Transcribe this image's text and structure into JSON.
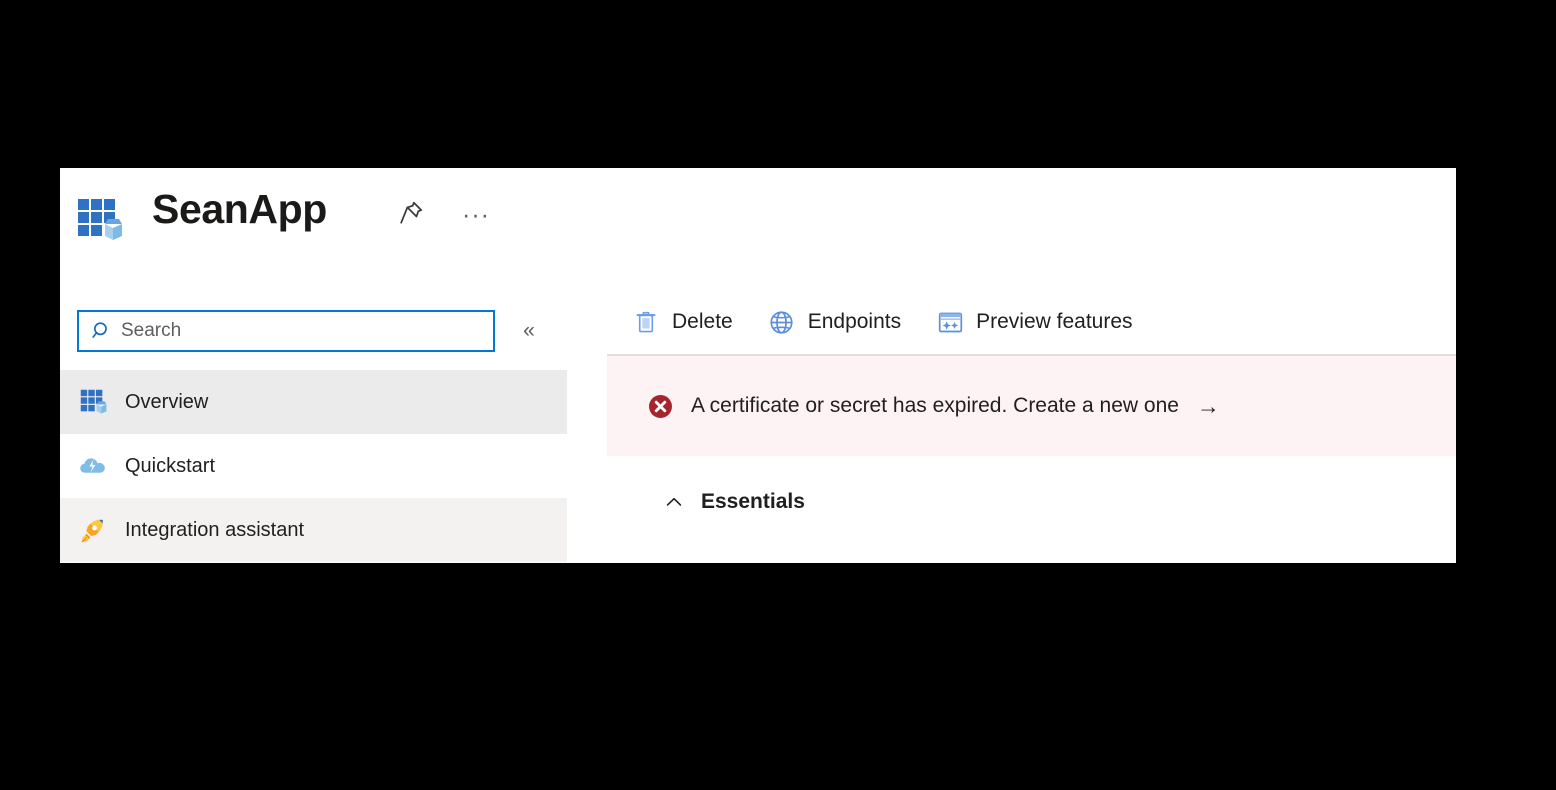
{
  "blade": {
    "title": "SeanApp",
    "app_icon": "app-registration-icon",
    "pin_icon": "pin-icon",
    "more_icon": "ellipsis-icon",
    "more_glyph": "···"
  },
  "search": {
    "placeholder": "Search",
    "icon": "search-icon",
    "collapse_icon": "double-chevron-left-icon",
    "collapse_glyph": "«"
  },
  "sidebar": {
    "items": [
      {
        "label": "Overview",
        "icon": "app-registration-icon",
        "state": "selected"
      },
      {
        "label": "Quickstart",
        "icon": "cloud-lightning-icon",
        "state": "plain"
      },
      {
        "label": "Integration assistant",
        "icon": "rocket-icon",
        "state": "alt"
      }
    ]
  },
  "toolbar": {
    "buttons": [
      {
        "label": "Delete",
        "icon": "trash-icon"
      },
      {
        "label": "Endpoints",
        "icon": "globe-icon"
      },
      {
        "label": "Preview features",
        "icon": "preview-features-icon"
      }
    ]
  },
  "banner": {
    "type": "error",
    "icon": "error-circle-x-icon",
    "message": "A certificate or secret has expired. Create a new one",
    "arrow_glyph": "→",
    "background": "#fdf3f4",
    "icon_color": "#a4262c"
  },
  "essentials": {
    "label": "Essentials",
    "chevron_icon": "chevron-up-icon",
    "expanded": true
  },
  "colors": {
    "accent": "#0078d4",
    "blade_background": "#ffffff",
    "selected_row": "#ebebeb",
    "alt_row": "#f3f2f1",
    "page_background": "#000000",
    "text": "#201f1e"
  }
}
